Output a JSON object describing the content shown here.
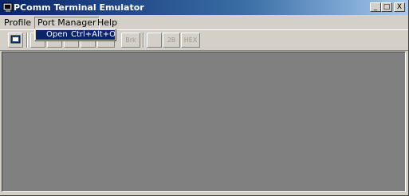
{
  "window": {
    "title": "PComm Terminal Emulator",
    "caption_buttons": {
      "minimize": "_",
      "maximize": "□",
      "close": "X"
    }
  },
  "menubar": {
    "items": [
      {
        "label": "Profile"
      },
      {
        "label": "Port Manager"
      },
      {
        "label": "Help"
      }
    ]
  },
  "dropdown": {
    "items": [
      {
        "label": "Open",
        "shortcut": "Ctrl+Alt+O"
      }
    ]
  },
  "toolbar": {
    "buttons": [
      {
        "icon": "open-profile-icon",
        "text": "",
        "enabled": true
      },
      {
        "icon": "settings-icon",
        "text": "",
        "enabled": false
      },
      {
        "icon": "tool-icon-a",
        "text": "",
        "enabled": false
      },
      {
        "icon": "tool-icon-b",
        "text": "",
        "enabled": false
      },
      {
        "icon": "tool-icon-c",
        "text": "",
        "enabled": false
      },
      {
        "icon": "break-icon",
        "text": "Brk",
        "enabled": false
      },
      {
        "icon": "transfer-icon",
        "text": "",
        "enabled": false
      },
      {
        "icon": "display-2b-icon",
        "text": "2B",
        "enabled": false
      },
      {
        "icon": "hex-icon",
        "text": "HEX",
        "enabled": false
      }
    ]
  },
  "colors": {
    "titlebar_start": "#0a246a",
    "titlebar_end": "#a6caf0",
    "client_bg": "#808080",
    "face": "#d4d0c8"
  }
}
